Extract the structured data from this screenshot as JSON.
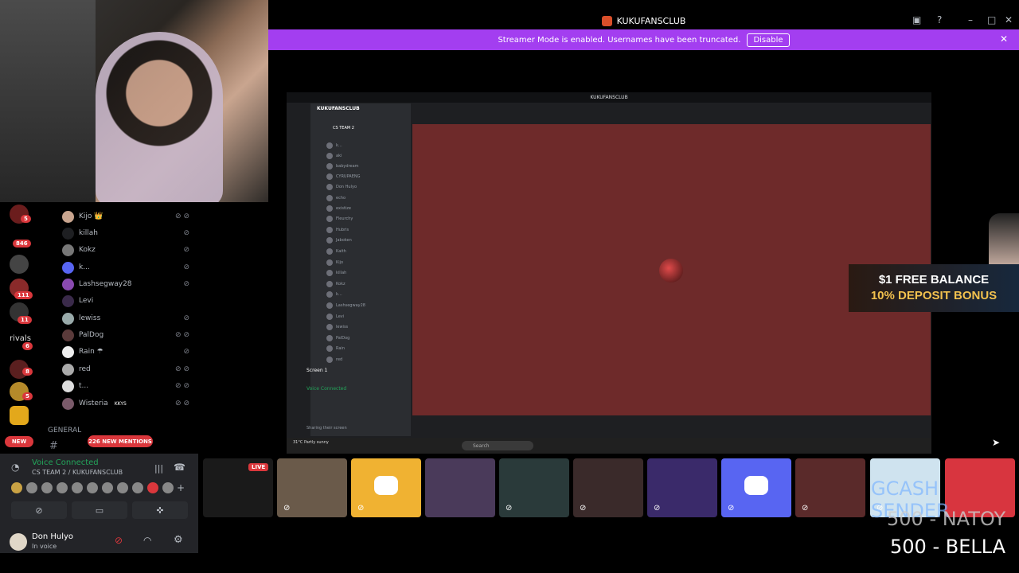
{
  "window": {
    "title": "KUKUFANSCLUB"
  },
  "banner": {
    "text": "Streamer Mode is enabled. Usernames have been truncated.",
    "disable_label": "Disable"
  },
  "rail": {
    "badges": [
      "5",
      "846",
      "111",
      "11",
      "6",
      "8",
      "5"
    ],
    "rivals_label": "rivals"
  },
  "members": [
    {
      "name": "Kijo 👑"
    },
    {
      "name": "killah"
    },
    {
      "name": "Kokz"
    },
    {
      "name": "k..."
    },
    {
      "name": "Lashsegway28"
    },
    {
      "name": "Levi"
    },
    {
      "name": "lewiss"
    },
    {
      "name": "PalDog"
    },
    {
      "name": "Rain ☂"
    },
    {
      "name": "red"
    },
    {
      "name": "t..."
    },
    {
      "name": "Wisteria",
      "tag": "KKYS"
    }
  ],
  "channel": {
    "general_label": "GENERAL",
    "new_label": "NEW",
    "mentions_label": "226 NEW MENTIONS"
  },
  "voice": {
    "title": "Voice Connected",
    "subtitle": "CS TEAM 2 / KUKUFANSCLUB"
  },
  "user": {
    "name": "Don Hulyo",
    "status": "In voice"
  },
  "inner": {
    "title": "KUKUFANSCLUB",
    "server": "KUKUFANSCLUB",
    "voice_channel": "CS TEAM 2",
    "members": [
      "k...",
      "aki",
      "babydream",
      "CYRUPAENG",
      "Don Hulyo",
      "echo",
      "existize",
      "Fleurchy",
      "Hubris",
      "Jaboken",
      "Kaith",
      "Kijo",
      "killah",
      "Kokz",
      "k...",
      "Lashsegway28",
      "Levi",
      "lewiss",
      "PalDog",
      "Rain",
      "red"
    ],
    "screen_label": "Screen 1",
    "voice_title": "Voice Connected",
    "search_placeholder": "Search",
    "weather": "31°C Partly sunny",
    "status": "Sharing their screen"
  },
  "ad": {
    "line1": "$1 FREE BALANCE",
    "line2": "10% DEPOSIT BONUS"
  },
  "tiles": {
    "live_label": "LIVE"
  },
  "donations": [
    "GCASH SENDER",
    "500 - NATOY",
    "500  - BELLA"
  ],
  "colors": {
    "banner": "#a33ef0",
    "stage": "#6e2a2a",
    "discord": "#5865f2",
    "voice_green": "#23a55a",
    "danger": "#da373c"
  }
}
